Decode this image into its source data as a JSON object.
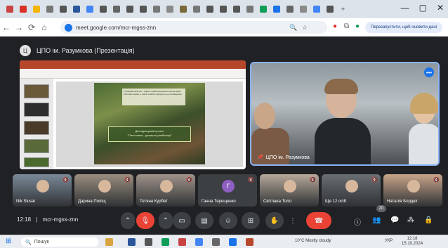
{
  "browser": {
    "url": "meet.google.com/mcr-mgss-znn",
    "update_label": "Перезапустити, щоб оновити дані",
    "tabs": [
      {
        "color": "#c94343"
      },
      {
        "color": "#d93025"
      },
      {
        "color": "#f4b400"
      },
      {
        "color": "#777777"
      },
      {
        "color": "#555555"
      },
      {
        "color": "#2b579a"
      },
      {
        "color": "#4285f4"
      },
      {
        "color": "#555555"
      },
      {
        "color": "#666666"
      },
      {
        "color": "#555555"
      },
      {
        "color": "#555555"
      },
      {
        "color": "#777777"
      },
      {
        "color": "#8a8a8a"
      },
      {
        "color": "#7a6a3a"
      },
      {
        "color": "#777777"
      },
      {
        "color": "#555555"
      },
      {
        "color": "#555555"
      },
      {
        "color": "#555555"
      },
      {
        "color": "#777777"
      },
      {
        "color": "#0f9d58"
      },
      {
        "color": "#1a73e8"
      },
      {
        "color": "#666666"
      },
      {
        "color": "#8a8a8a"
      },
      {
        "color": "#4285f4"
      },
      {
        "color": "#555555"
      }
    ],
    "window_controls": [
      "—",
      "▢",
      "✕"
    ],
    "new_tab": "+",
    "close_tab": "✕"
  },
  "meet": {
    "presenter_title": "ЦПО ім. Разумкова (Презентація)",
    "presenter_initial": "Ц",
    "slide": {
      "text_box": "Глянецеві палички – однин з найпоширеніших серед видів листових комах, а також їх вибір підходить для розведення",
      "title_line1": "Дослідницький проєкт",
      "title_line2": "\"Палочники - домашні улюбленці\""
    },
    "camera_name": "ЦПО ім. Разумкова",
    "participants": [
      {
        "name": "Nik Slusar",
        "avatar_color": "#7a8a99",
        "initial": ""
      },
      {
        "name": "Дарина Поліщ",
        "avatar_color": "#9a8e80",
        "initial": ""
      },
      {
        "name": "Тетяна Курбет",
        "avatar_color": "#a0938a",
        "initial": ""
      },
      {
        "name": "Ганна Терещенко",
        "avatar_color": "#8e5fc2",
        "initial": "Г"
      },
      {
        "name": "Світлана Толо",
        "avatar_color": "#b7a89a",
        "initial": ""
      },
      {
        "name": "Ще 12 осіб",
        "avatar_color": "#6a6f74",
        "initial": ""
      },
      {
        "name": "Наталія Бордюг",
        "avatar_color": "#c9a58a",
        "initial": ""
      }
    ],
    "time": "12:18",
    "meeting_code": "mcr-mgss-znn",
    "participant_count": "20"
  },
  "taskbar": {
    "search_placeholder": "Пошук",
    "weather": "10°C  Mostly cloudy",
    "lang": "УКР",
    "time": "12:18",
    "date": "15.10.2024"
  }
}
